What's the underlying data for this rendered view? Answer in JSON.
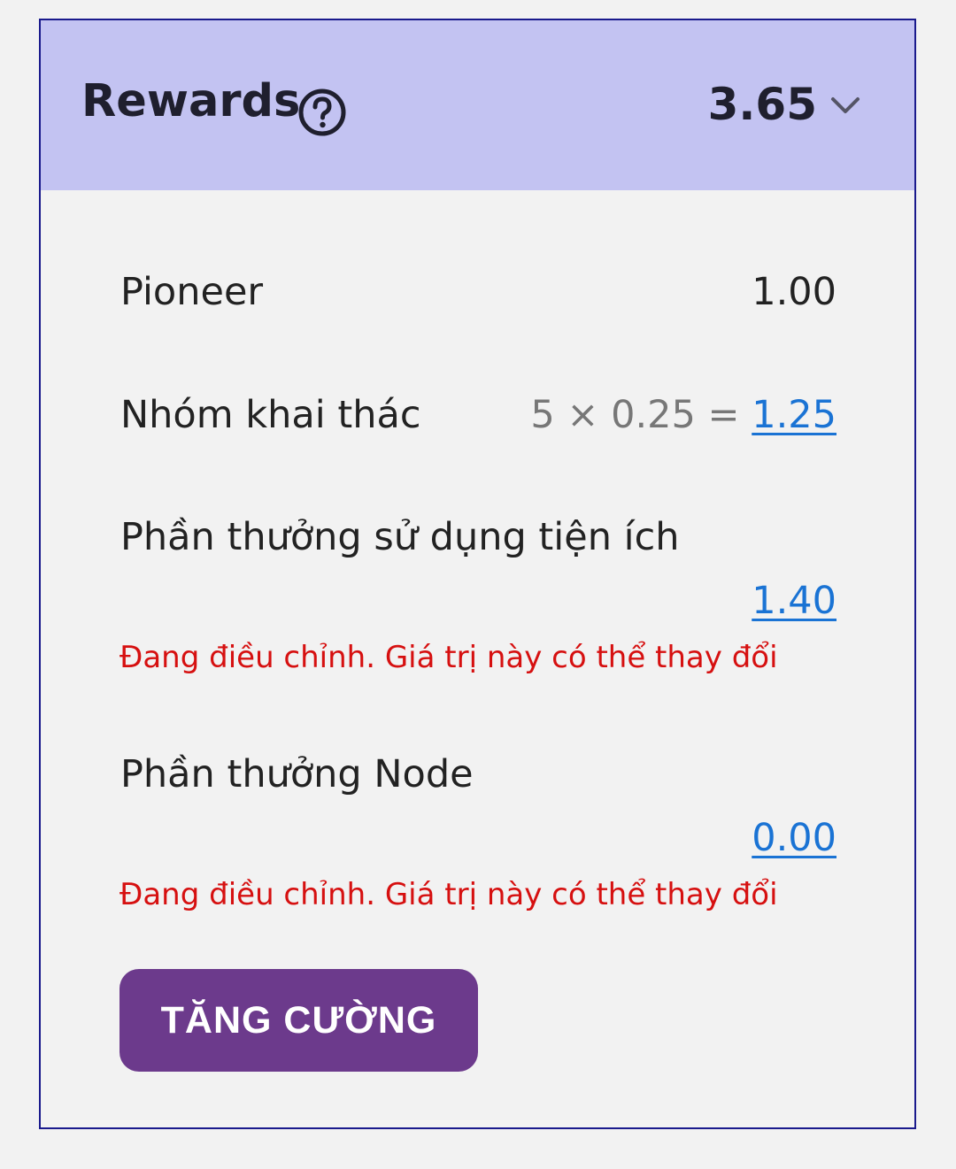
{
  "header": {
    "title": "Rewards",
    "help_icon": "question-circle-icon",
    "total": "3.65",
    "expand_icon": "chevron-down-icon"
  },
  "rows": [
    {
      "label": "Pioneer",
      "value": "1.00"
    },
    {
      "label": "Nhóm khai thác",
      "formula": "5 × 0.25 =",
      "value": "1.25"
    },
    {
      "label": "Phần thưởng sử dụng tiện ích",
      "value": "1.40",
      "warning": "Đang điều chỉnh. Giá trị này có thể thay đổi"
    },
    {
      "label": "Phần thưởng Node",
      "value": "0.00",
      "warning": "Đang điều chỉnh. Giá trị này có thể thay đổi"
    }
  ],
  "button": {
    "label": "TĂNG CƯỜNG"
  },
  "colors": {
    "header_bg": "#c3c3f2",
    "card_border": "#1a1a8c",
    "link": "#1a73d4",
    "warning": "#d61010",
    "button_bg": "#6c3a8c"
  }
}
